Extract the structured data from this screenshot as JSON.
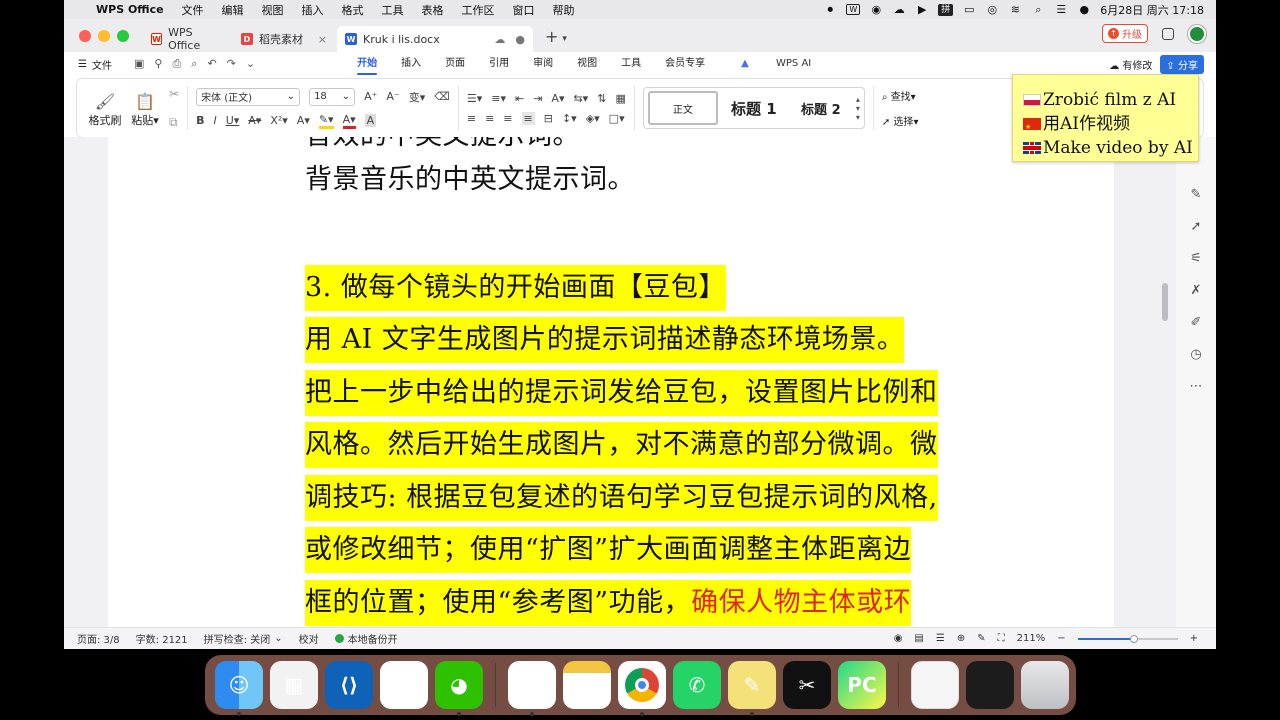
{
  "menubar": {
    "app_name": "WPS Office",
    "items": [
      "文件",
      "编辑",
      "视图",
      "插入",
      "格式",
      "工具",
      "表格",
      "工作区",
      "窗口",
      "帮助"
    ],
    "input_method": "拼",
    "datetime": "6月28日 周六  17:18"
  },
  "tabs": [
    {
      "label": "WPS Office"
    },
    {
      "label": "稻壳素材"
    },
    {
      "label": "Kruk i lis.docx"
    }
  ],
  "window_controls": {
    "upgrade": "升级"
  },
  "ribbon_tabs": {
    "file": "文件",
    "items": [
      "开始",
      "插入",
      "页面",
      "引用",
      "审阅",
      "视图",
      "工具",
      "会员专享"
    ],
    "wps_ai": "WPS AI",
    "has_changes": "有修改",
    "share": "分享"
  },
  "ribbon": {
    "format_painter": "格式刷",
    "paste": "粘贴",
    "font_name": "宋体 (正文)",
    "font_size": "18",
    "style_normal": "正文",
    "style_h1": "标题 1",
    "style_h2": "标题 2",
    "find": "查找",
    "select": "选择"
  },
  "document": {
    "lines": [
      {
        "text": "音效的中英文提示词。",
        "highlight": false
      },
      {
        "text": "背景音乐的中英文提示词。",
        "highlight": false
      },
      {
        "text": "3. 做每个镜头的开始画面【豆包】",
        "highlight": true
      },
      {
        "text": "用 AI 文字生成图片的提示词描述静态环境场景。",
        "highlight": true
      },
      {
        "text": "把上一步中给出的提示词发给豆包，设置图片比例和",
        "highlight": true
      },
      {
        "text": "风格。然后开始生成图片，对不满意的部分微调。微",
        "highlight": true
      },
      {
        "text": "调技巧: 根据豆包复述的语句学习豆包提示词的风格,",
        "highlight": true
      },
      {
        "text": "或修改细节；使用“扩图”扩大画面调整主体距离边",
        "highlight": true
      },
      {
        "text": "框的位置；使用“参考图”功能，",
        "highlight": true
      }
    ],
    "last_line_red": "确保人物主体或环"
  },
  "statusbar": {
    "page": "页面: 3/8",
    "words": "字数: 2121",
    "spellcheck": "拼写检查: 关闭",
    "proofread": "校对",
    "backup": "本地备份开",
    "zoom": "211%"
  },
  "note": {
    "lines": [
      "Zrobić film z AI",
      "用AI作视频",
      "Make video by AI"
    ]
  },
  "colors": {
    "highlight": "#ffff00",
    "accent": "#2a62d8",
    "red_text": "#e0261c",
    "note_bg": "#ffff96"
  }
}
